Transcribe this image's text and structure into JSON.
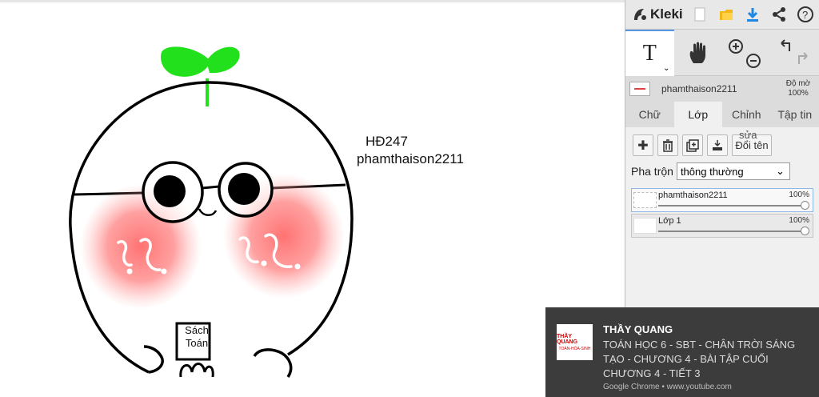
{
  "app": {
    "name": "Kleki"
  },
  "canvas": {
    "text_line1": "HĐ247",
    "text_line2": "phamthaison2211",
    "box_label_line1": "Sách",
    "box_label_line2": "Toán"
  },
  "panel": {
    "current_layer": {
      "name": "phamthaison2211",
      "opacity_label": "Độ mờ",
      "opacity_value": "100%"
    },
    "tool_text_glyph": "T",
    "tabs": [
      {
        "label": "Chữ",
        "active": false
      },
      {
        "label": "Lớp",
        "active": true
      },
      {
        "label": "Chỉnh",
        "active": false
      },
      {
        "label": "Tập tin",
        "active": false
      }
    ],
    "actions": {
      "rename_above": "sửa",
      "rename_label": "Đổi tên"
    },
    "blend": {
      "label": "Pha trộn",
      "value": "thông thường"
    },
    "layers": [
      {
        "name": "phamthaison2211",
        "opacity": "100%",
        "selected": true
      },
      {
        "name": "Lớp 1",
        "opacity": "100%",
        "selected": false
      }
    ]
  },
  "notification": {
    "icon_text_line1": "THẦY QUANG",
    "icon_text_line2": "TOÁN-HÓA-SINH",
    "title": "THẦY QUANG",
    "body": "TOÁN HỌC 6 - SBT - CHÂN TRỜI SÁNG TẠO - CHƯƠNG 4 - BÀI TẬP CUỐI CHƯƠNG 4 - TIẾT 3",
    "source": "Google Chrome • www.youtube.com"
  },
  "colors": {
    "leaf": "#22e01c",
    "blush": "#ff7070",
    "accent": "#1e88e5"
  }
}
